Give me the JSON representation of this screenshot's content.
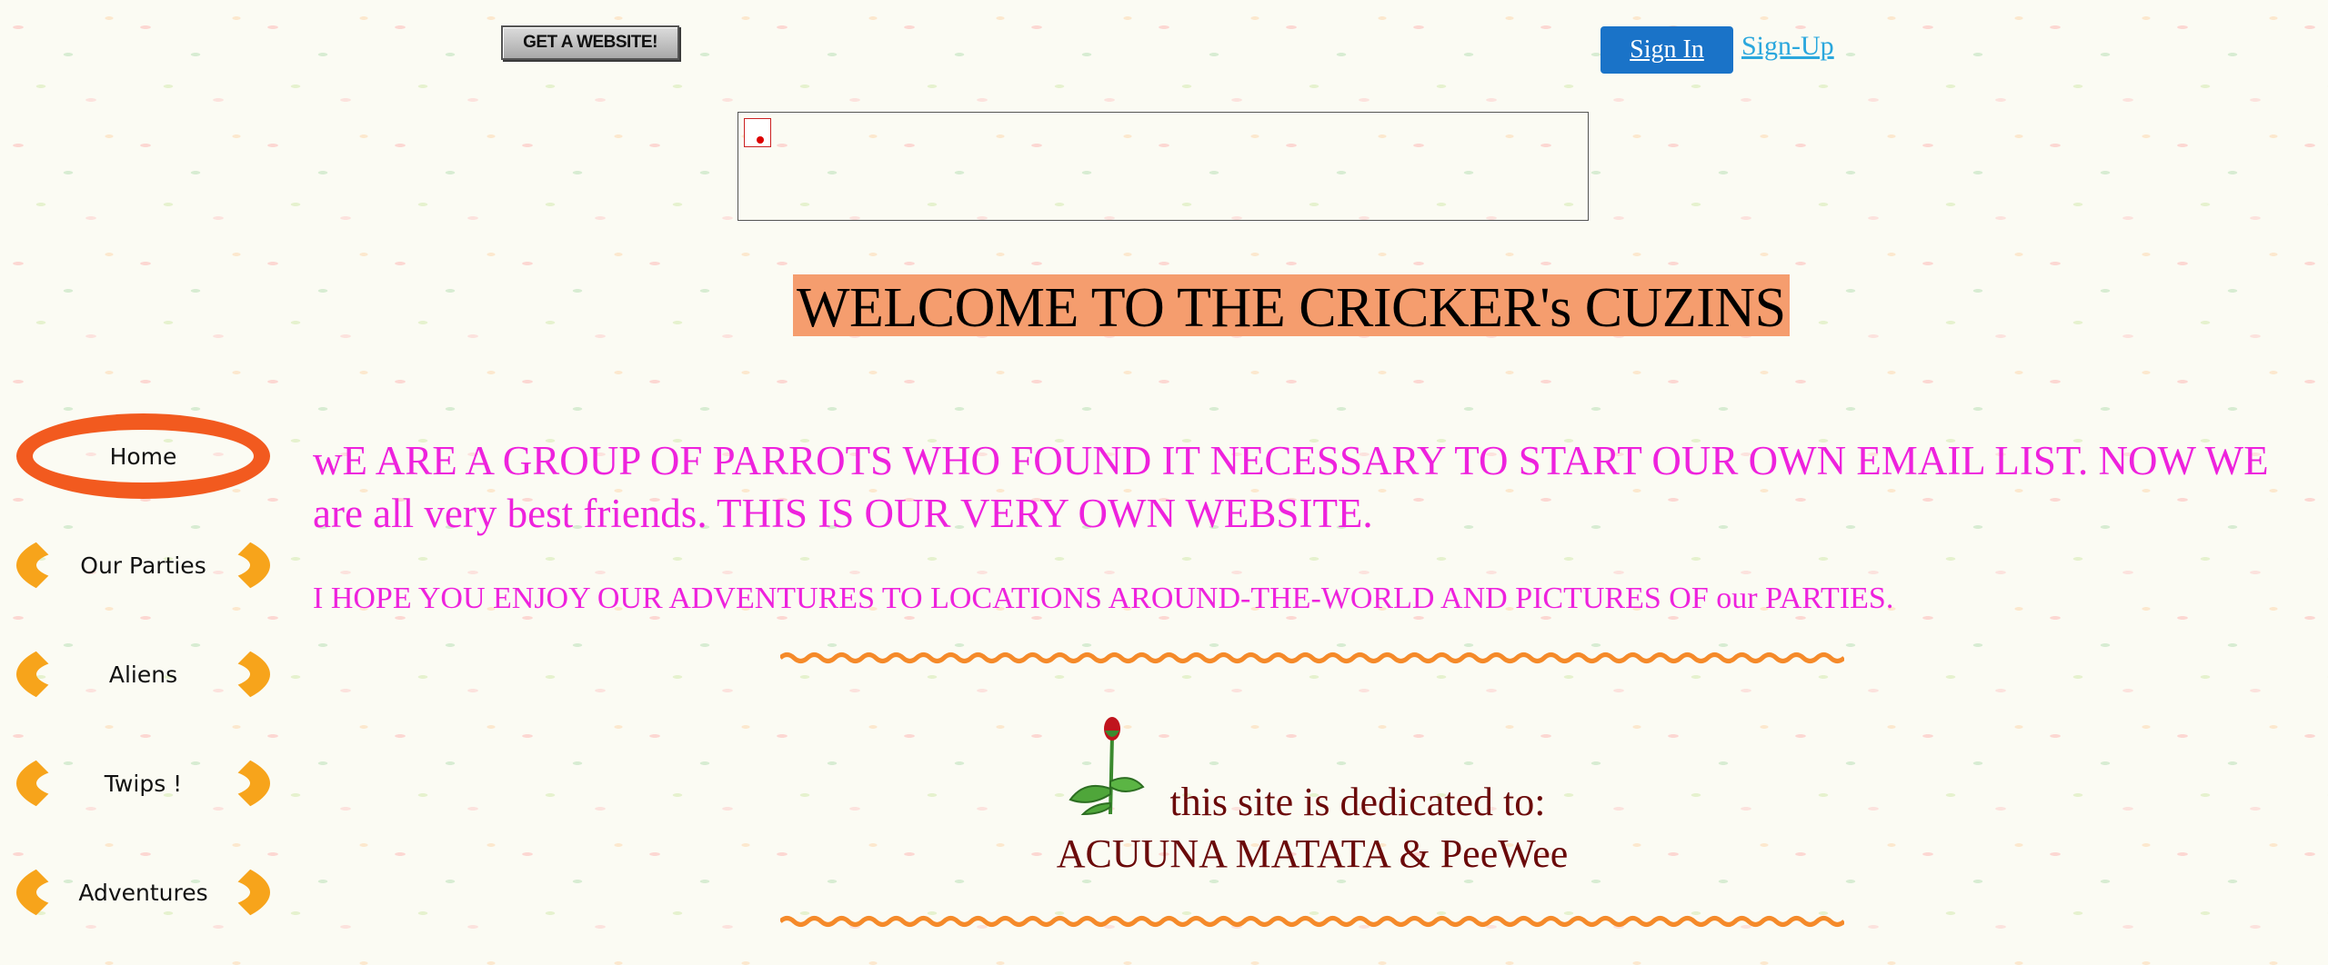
{
  "header": {
    "get_website_label": "GET A WEBSITE!",
    "sign_in_label": "Sign In",
    "sign_up_label": "Sign-Up"
  },
  "page": {
    "title": "WELCOME TO THE CRICKER's CUZINS",
    "intro_main": "wE ARE A GROUP OF PARROTS WHO FOUND IT NECESSARY TO START OUR OWN EMAIL LIST. NOW WE are all very best friends. THIS IS OUR VERY OWN WEBSITE.",
    "intro_sub": "I HOPE YOU ENJOY OUR ADVENTURES TO LOCATIONS AROUND-THE-WORLD AND PICTURES OF our PARTIES.",
    "dedication_line1": "this site is dedicated to:",
    "dedication_line2": "ACUUNA MATATA & PeeWee"
  },
  "nav": {
    "items": [
      {
        "label": "Home",
        "active": true
      },
      {
        "label": "Our Parties",
        "active": false
      },
      {
        "label": "Aliens",
        "active": false
      },
      {
        "label": "Twips !",
        "active": false
      },
      {
        "label": "Adventures",
        "active": false
      }
    ]
  },
  "colors": {
    "title_highlight": "#f59d6e",
    "intro_text": "#ee22dd",
    "dedication_text": "#6b0a0a",
    "nav_active": "#f25a1f",
    "nav_inactive": "#f7a41b",
    "sign_in_bg": "#1a73c8",
    "divider": "#f58a2a"
  }
}
